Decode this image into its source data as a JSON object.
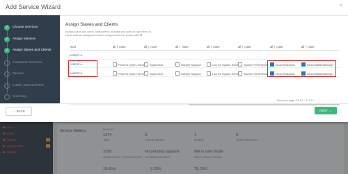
{
  "background": {
    "nav_items": [
      "Hive",
      "Kafka",
      "Ranger",
      "Smartsense",
      "Spark2"
    ],
    "badges": [
      "",
      "",
      "8",
      "8",
      ""
    ],
    "section_title": "Service Metrics",
    "metrics_row1": [
      {
        "value": "BLOCKS",
        "label": ""
      },
      {
        "value": "1374",
        "label": "Total"
      },
      {
        "value": "3",
        "label": "Corrupt Replica"
      },
      {
        "value": "1",
        "label": "Missing"
      },
      {
        "value": "9",
        "label": "Under Replicated"
      }
    ],
    "metrics_row2": [
      {
        "value": "3198",
        "label": "TOTAL FILES + DIRECTORIES"
      },
      {
        "value": "No pending upgrade",
        "label": "UPGRADE STATUS"
      },
      {
        "value": "Not in safe mode",
        "label": "SAFE MODE STATUS"
      }
    ],
    "metrics_row3": [
      "19.45%",
      "9.33%",
      "75.20%"
    ]
  },
  "modal": {
    "title": "Add Service Wizard",
    "close": "×",
    "steps": [
      {
        "label": "Choose Services",
        "state": "done"
      },
      {
        "label": "Assign Masters",
        "state": "done"
      },
      {
        "label": "Assign Slaves and Clients",
        "state": "active"
      },
      {
        "label": "Customize Services",
        "state": "todo"
      },
      {
        "label": "Review",
        "state": "todo"
      },
      {
        "label": "Install, Start and Test",
        "state": "todo"
      },
      {
        "label": "Summary",
        "state": "todo"
      }
    ],
    "heading": "Assign Slaves and Clients",
    "description": [
      "Assign slave and client components to hosts you want to run them on.",
      "Hosts that are assigned master components are shown with ✱."
    ],
    "table": {
      "host_header": "Host",
      "all_label": "all",
      "none_label": "none",
      "columns": [
        "Phoenix Query Server",
        "Supervisor",
        "Ranger Tagsync",
        "Livy for Spark2 Server",
        "Spark2 Thrift Server",
        "Druid Historical",
        "Druid MiddleManager"
      ],
      "header_checks": [
        false,
        false,
        false,
        true,
        true,
        true,
        true
      ],
      "rows": [
        {
          "host": "node01.a",
          "checks": [
            false,
            false,
            false,
            false,
            false,
            false,
            false
          ]
        },
        {
          "host": "node02.a",
          "checks": [
            false,
            false,
            false,
            false,
            false,
            true,
            true
          ]
        },
        {
          "host": "node03.a",
          "checks": [
            false,
            false,
            false,
            false,
            false,
            true,
            true
          ]
        }
      ],
      "pager": "Items per page: 25 ▾   1 - 3 of 3  ‹  ›"
    },
    "back_label": "← BACK",
    "next_label": "NEXT →"
  }
}
